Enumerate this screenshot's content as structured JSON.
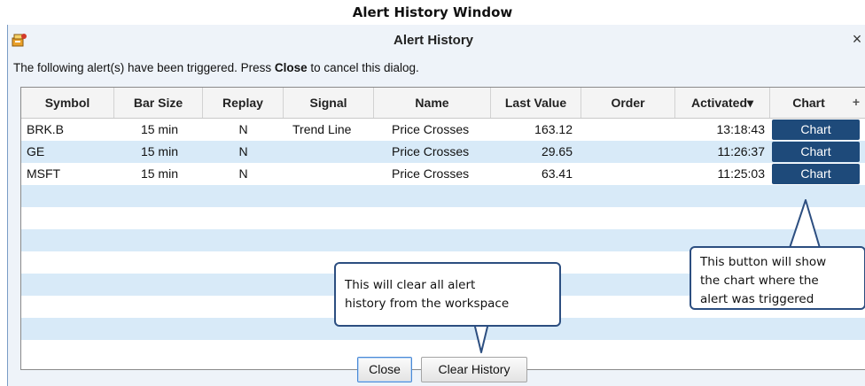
{
  "doc_title": "Alert History Window",
  "window": {
    "title": "Alert History",
    "close_glyph": "×",
    "app_icon": "alert-app-icon"
  },
  "message": {
    "before": "The following alert(s) have been triggered.  Press ",
    "bold": "Close",
    "after": " to cancel this dialog."
  },
  "table": {
    "columns": [
      "Symbol",
      "Bar Size",
      "Replay",
      "Signal",
      "Name",
      "Last Value",
      "Order",
      "Activated▾",
      "Chart"
    ],
    "add_column_glyph": "+",
    "rows": [
      {
        "symbol": "BRK.B",
        "bar_size": "15 min",
        "replay": "N",
        "signal": "Trend Line",
        "name": "Price Crosses",
        "last_value": "163.12",
        "order": "",
        "activated": "13:18:43",
        "chart": "Chart"
      },
      {
        "symbol": "GE",
        "bar_size": "15 min",
        "replay": "N",
        "signal": "",
        "name": "Price Crosses",
        "last_value": "29.65",
        "order": "",
        "activated": "11:26:37",
        "chart": "Chart"
      },
      {
        "symbol": "MSFT",
        "bar_size": "15 min",
        "replay": "N",
        "signal": "",
        "name": "Price Crosses",
        "last_value": "63.41",
        "order": "",
        "activated": "11:25:03",
        "chart": "Chart"
      }
    ]
  },
  "buttons": {
    "close": "Close",
    "clear_history": "Clear History"
  },
  "callouts": {
    "chart": [
      "This button will show",
      "the chart where the",
      "alert was triggered"
    ],
    "clear": [
      "This will clear all alert",
      "history from the workspace"
    ]
  },
  "colors": {
    "chart_button": "#1e4a7a",
    "alt_row": "#d8eaf8",
    "callout_border": "#2c4e80"
  }
}
